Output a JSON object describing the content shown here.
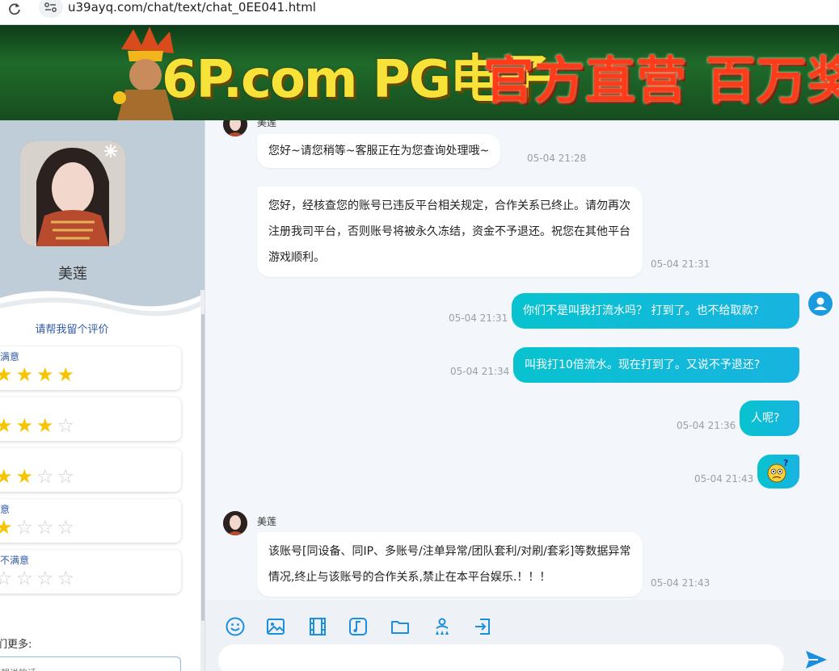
{
  "browser": {
    "url": "u39ayq.com/chat/text/chat_0EE041.html"
  },
  "banner": {
    "text_brand": "6P.com PG电子",
    "text_slogan": "官方直营 百万奖池"
  },
  "sidebar": {
    "agent_name": "美莲",
    "rating_title": "请帮我留个评价",
    "ratings": [
      {
        "label": "满意",
        "stars": 4
      },
      {
        "label": "",
        "stars": 3
      },
      {
        "label": "",
        "stars": 2
      },
      {
        "label": "意",
        "stars": 1
      },
      {
        "label": "不满意",
        "stars": 0
      }
    ],
    "more_label": "们更多:",
    "more_placeholder": "想说的话"
  },
  "chat": {
    "messages": [
      {
        "from": "agent",
        "sender": "美莲",
        "text": "您好~请您稍等~客服正在为您查询处理哦~",
        "time": "05-04 21:28"
      },
      {
        "from": "agent",
        "text": "您好，经核查您的账号已违反平台相关规定，合作关系已终止。请勿再次注册我司平台，否则账号将被永久冻结，资金不予退还。祝您在其他平台游戏顺利。",
        "time": "05-04 21:31"
      },
      {
        "from": "user",
        "text": "你们不是叫我打流水吗？ 打到了。也不给取款?",
        "time": "05-04 21:31"
      },
      {
        "from": "user",
        "text": "叫我打10倍流水。现在打到了。又说不予退还?",
        "time": "05-04 21:34"
      },
      {
        "from": "user",
        "text": "人呢?",
        "time": "05-04 21:36"
      },
      {
        "from": "user",
        "emoji": "confused-emoji",
        "time": "05-04 21:43"
      },
      {
        "from": "agent",
        "sender": "美莲",
        "text": "该账号[同设备、同IP、多账号/注单异常/团队套利/对刷/套彩]等数据异常情况,终止与该账号的合作关系,禁止在本平台娱乐.！！！",
        "time": "05-04 21:43"
      }
    ]
  },
  "toolbar": {
    "icons": [
      "smile-icon",
      "image-icon",
      "video-icon",
      "music-icon",
      "folder-icon",
      "transfer-agent-icon",
      "exit-icon"
    ]
  },
  "composer": {
    "placeholder": ""
  },
  "colors": {
    "accent": "#18b3e0",
    "bubble_out": "#08c3cf",
    "star": "#f8c400",
    "link": "#2f5ba8"
  }
}
